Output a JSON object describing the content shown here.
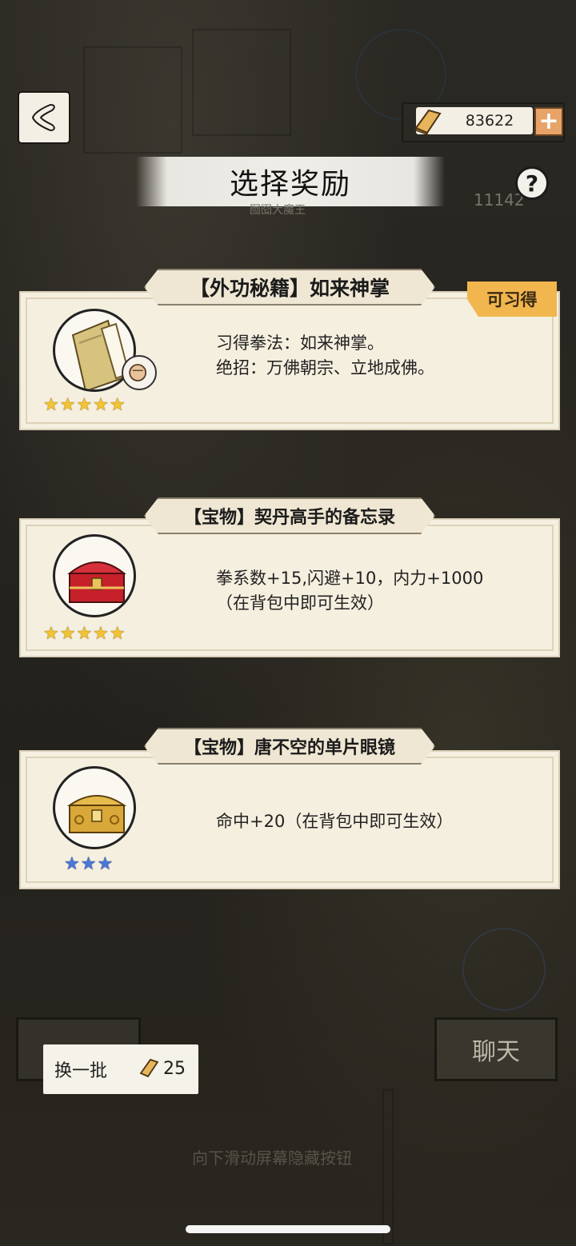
{
  "header": {
    "back_icon": "back-arrow-icon",
    "currency": {
      "icon": "gold-ingot-icon",
      "value": "83622",
      "add_icon": "plus-icon"
    },
    "title": "选择奖励",
    "help_icon": "question-mark-icon",
    "background_currency": "11142",
    "background_name": "囫囵大魔王"
  },
  "rewards": [
    {
      "tag": "【外功秘籍】如来神掌",
      "badge": "可习得",
      "icon": "scroll-book-icon",
      "sub_icon": "fist-icon",
      "stars": "★★★★★",
      "star_color": "#f3c431",
      "desc_lines": [
        "习得拳法：如来神掌。",
        "绝招：万佛朝宗、立地成佛。"
      ]
    },
    {
      "tag": "【宝物】契丹高手的备忘录",
      "icon": "red-treasure-chest-icon",
      "stars": "★★★★★",
      "star_color": "#f3c431",
      "desc_lines": [
        "拳系数+15,闪避+10，内力+1000",
        "（在背包中即可生效）"
      ]
    },
    {
      "tag": "【宝物】唐不空的单片眼镜",
      "icon": "gold-treasure-chest-icon",
      "stars": "★★★",
      "star_color": "#4b78d6",
      "desc_lines": [
        "命中+20（在背包中即可生效）"
      ]
    }
  ],
  "footer": {
    "refresh_label": "换一批",
    "refresh_cost": "25",
    "chat_label": "聊天",
    "hint": "向下滑动屏幕隐藏按钮"
  }
}
